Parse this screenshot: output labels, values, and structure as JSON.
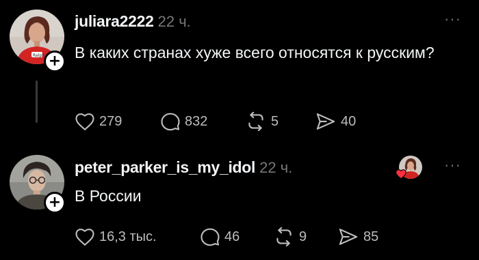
{
  "posts": [
    {
      "username": "juliara2222",
      "time": "22 ч.",
      "text": "В каких странах хуже всего относятся к русским?",
      "follow_symbol": "+",
      "more_symbol": "···",
      "stats": {
        "likes": "279",
        "comments": "832",
        "reposts": "5",
        "shares": "40"
      }
    },
    {
      "username": "peter_parker_is_my_idol",
      "time": "22 ч.",
      "text": "В России",
      "follow_symbol": "+",
      "more_symbol": "···",
      "stats": {
        "likes": "16,3 тыс.",
        "comments": "46",
        "reposts": "9",
        "shares": "85"
      }
    }
  ],
  "colors": {
    "background": "#000000",
    "primary_text": "#f3f5f7",
    "secondary_text": "#777777",
    "action_text": "#bdbdbd",
    "liked_heart": "#ff3040"
  },
  "icons": {
    "like": "heart-icon",
    "comment": "comment-bubble-icon",
    "repost": "repost-arrows-icon",
    "share": "send-plane-icon",
    "more": "more-dots-icon"
  }
}
